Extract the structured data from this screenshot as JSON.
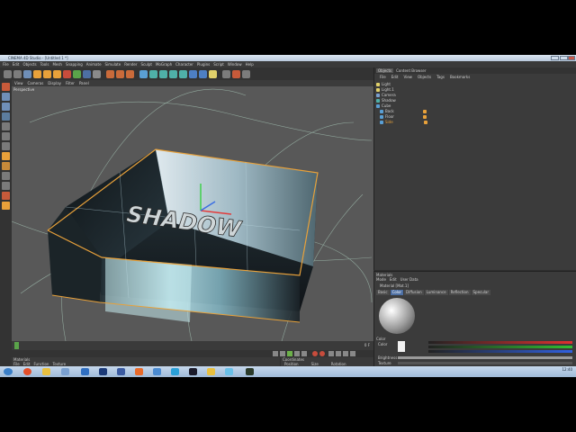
{
  "window": {
    "title": "CINEMA 4D Studio - [Untitled 1 *]"
  },
  "menu": [
    "File",
    "Edit",
    "Objects",
    "Tools",
    "Mesh",
    "Snapping",
    "Animate",
    "Simulate",
    "Render",
    "Sculpt",
    "MoGraph",
    "Character",
    "Plugins",
    "Script",
    "Window",
    "Help"
  ],
  "viewport": {
    "menu": [
      "View",
      "Cameras",
      "Display",
      "Filter",
      "Panel"
    ],
    "label": "Perspective",
    "scene_text": "SHADOW"
  },
  "object_manager": {
    "tabs": [
      "Objects",
      "Content Browser"
    ],
    "menu": [
      "File",
      "Edit",
      "View",
      "Objects",
      "Tags",
      "Bookmarks"
    ],
    "objects": [
      "Light",
      "Light.1",
      "Camera",
      "Shadow",
      "Cube",
      "Back",
      "Floor",
      "Side"
    ]
  },
  "attribute_manager": {
    "header": "Materials",
    "menu": [
      "Mode",
      "Edit",
      "User Data"
    ],
    "title": "Material [Mat.1]",
    "tabs": [
      "Basic",
      "Color",
      "Diffusion",
      "Luminance",
      "Reflection",
      "Specular"
    ],
    "section": "Color",
    "fields": [
      "Color",
      "Brightness",
      "Texture",
      "Mix Mode",
      "Mix Strength"
    ]
  },
  "material_manager": {
    "header": "Materials",
    "menu": [
      "File",
      "Edit",
      "Function",
      "Texture"
    ]
  },
  "coordinates": {
    "header": "Coordinates",
    "columns": [
      "Position",
      "Size",
      "Rotation"
    ],
    "apply_label": "Apply"
  },
  "timeline": {
    "frame": "0 F"
  },
  "taskbar": {
    "time": "12:40"
  },
  "colors": {
    "accent_orange": "#e8a13a",
    "selection_blue": "#4d6fa3",
    "ui_dark": "#2e2e2e",
    "taskbar_blue": "#b3cbe5"
  }
}
